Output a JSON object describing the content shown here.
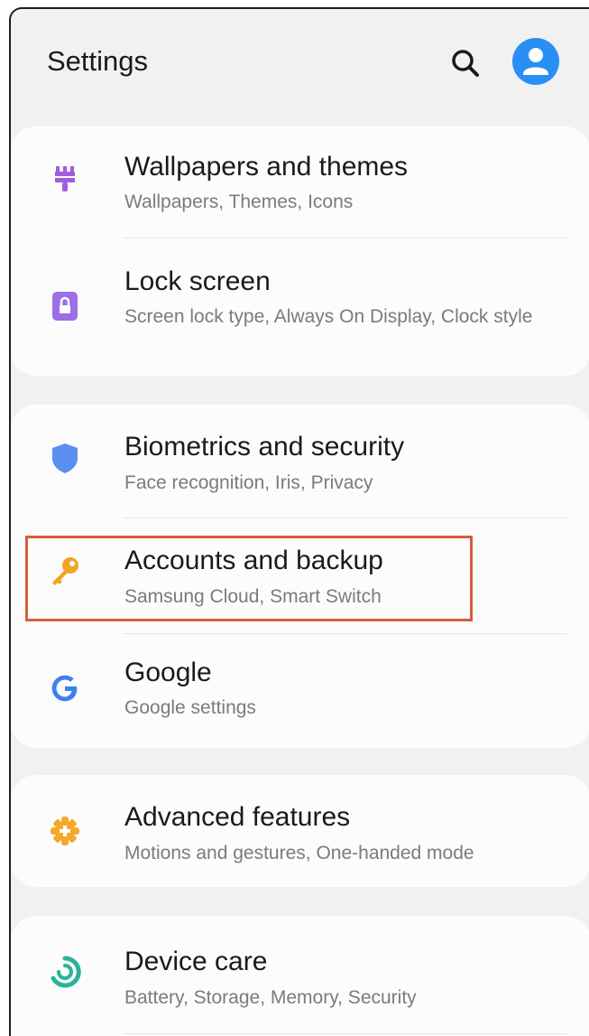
{
  "header": {
    "title": "Settings",
    "search_icon": "search-icon",
    "avatar_icon": "account-avatar-icon"
  },
  "items": [
    {
      "label": "Wallpapers and themes",
      "sub": "Wallpapers, Themes, Icons",
      "icon": "paintbrush-icon",
      "icon_color": "#a25ce0"
    },
    {
      "label": "Lock screen",
      "sub": "Screen lock type, Always On Display, Clock style",
      "icon": "lock-icon",
      "icon_color": "#9b6fe6"
    },
    {
      "label": "Biometrics and security",
      "sub": "Face recognition, Iris, Privacy",
      "icon": "shield-icon",
      "icon_color": "#5c8ef0"
    },
    {
      "label": "Accounts and backup",
      "sub": "Samsung Cloud, Smart Switch",
      "icon": "key-icon",
      "icon_color": "#f2a422"
    },
    {
      "label": "Google",
      "sub": "Google settings",
      "icon": "google-icon",
      "icon_color": "#3f7ff2"
    },
    {
      "label": "Advanced features",
      "sub": "Motions and gestures, One-handed mode",
      "icon": "gear-plus-icon",
      "icon_color": "#f5a82a"
    },
    {
      "label": "Device care",
      "sub": "Battery, Storage, Memory, Security",
      "icon": "device-care-icon",
      "icon_color": "#2bb39a"
    }
  ],
  "colors": {
    "background": "#f1f1f1",
    "card": "#fcfcfc",
    "highlight_border": "#d45f3c",
    "avatar": "#2a8ff5"
  }
}
